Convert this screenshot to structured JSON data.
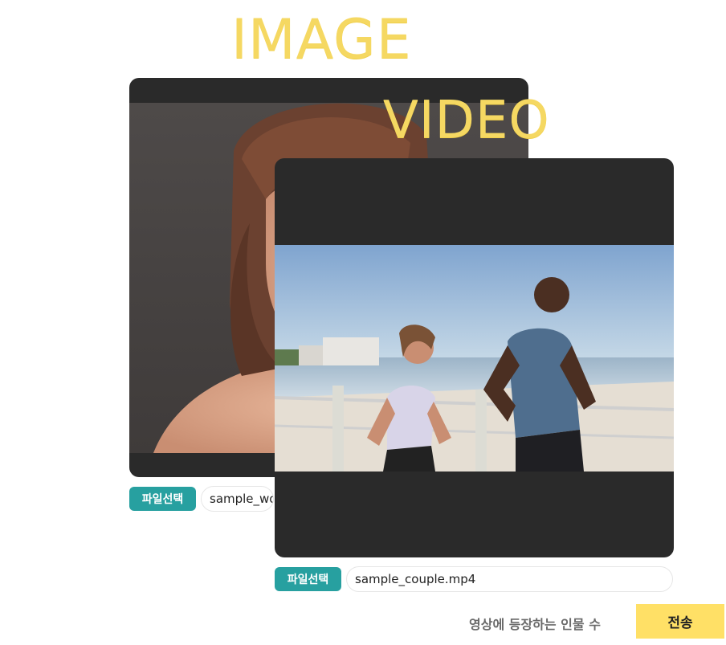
{
  "headings": {
    "image": "IMAGE",
    "video": "VIDEO"
  },
  "image_upload": {
    "button_label": "파일선택",
    "file_name": "sample_wo"
  },
  "video_upload": {
    "button_label": "파일선택",
    "file_name": "sample_couple.mp4"
  },
  "footer": {
    "count_label": "영상에 등장하는 인물 수",
    "submit_label": "전송"
  },
  "colors": {
    "heading": "#f5d862",
    "panel": "#2a2a2a",
    "file_button": "#27a0a0",
    "submit_button": "#ffe066"
  }
}
